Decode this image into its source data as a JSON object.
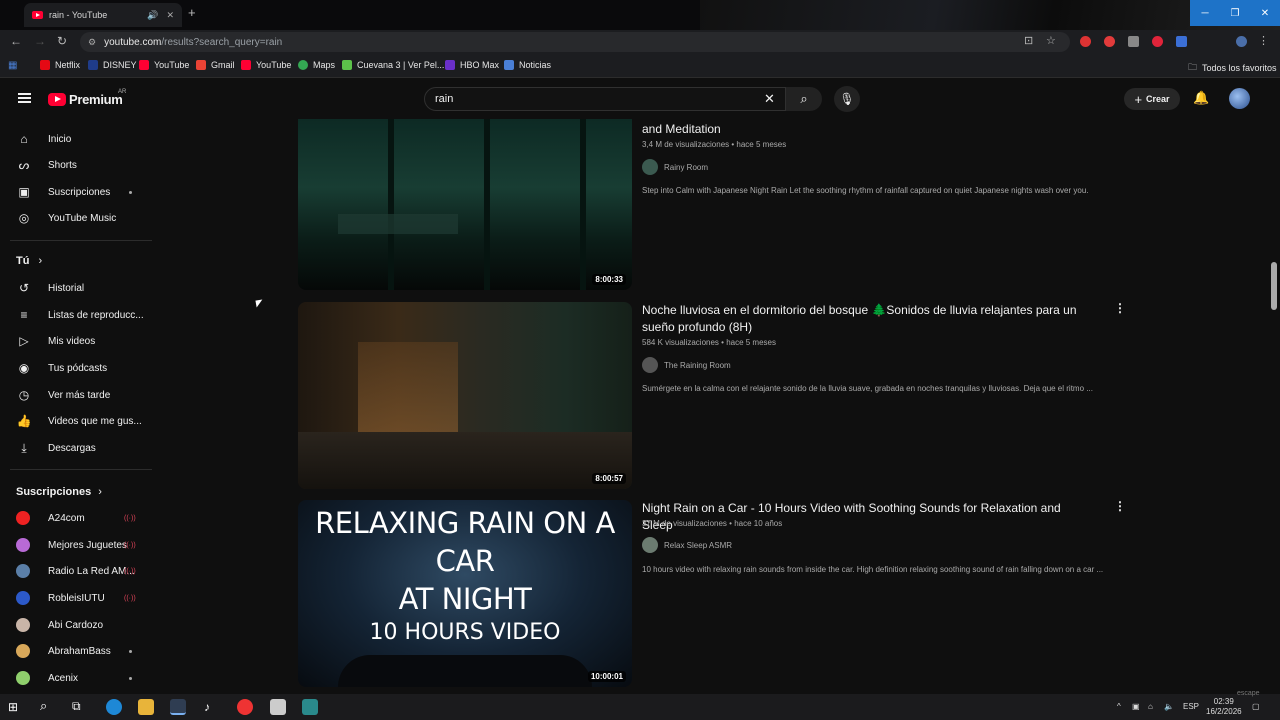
{
  "browser": {
    "tab_title": "rain - YouTube",
    "new_tab_icon": "+",
    "url_domain": "youtube.com",
    "url_path": "/results?search_query=rain",
    "bookmarks": [
      {
        "label": "Netflix",
        "color": "#e50914"
      },
      {
        "label": "DISNEY",
        "color": "#1f3c8a"
      },
      {
        "label": "YouTube",
        "color": "#ff0033"
      },
      {
        "label": "Gmail",
        "color": "#ea4335"
      },
      {
        "label": "YouTube",
        "color": "#ff0033"
      },
      {
        "label": "Maps",
        "color": "#34a853"
      },
      {
        "label": "Cuevana 3 | Ver Pel...",
        "color": "#5cc24a"
      },
      {
        "label": "HBO Max",
        "color": "#6a2fc9"
      },
      {
        "label": "Noticias",
        "color": "#4a7fd6"
      }
    ],
    "favorites_label": "Todos los favoritos"
  },
  "header": {
    "logo_text": "Premium",
    "logo_region": "AR",
    "search_query": "rain",
    "create_label": "Crear"
  },
  "sidebar": {
    "main": [
      {
        "label": "Inicio",
        "icon": "home-icon"
      },
      {
        "label": "Shorts",
        "icon": "shorts-icon"
      },
      {
        "label": "Suscripciones",
        "icon": "subscriptions-icon"
      },
      {
        "label": "YouTube Music",
        "icon": "music-icon"
      }
    ],
    "you_heading": "Tú",
    "you": [
      {
        "label": "Historial",
        "icon": "history-icon"
      },
      {
        "label": "Listas de reproducc...",
        "icon": "playlists-icon"
      },
      {
        "label": "Mis videos",
        "icon": "my-videos-icon"
      },
      {
        "label": "Tus pódcasts",
        "icon": "podcasts-icon"
      },
      {
        "label": "Ver más tarde",
        "icon": "watch-later-icon"
      },
      {
        "label": "Videos que me gus...",
        "icon": "liked-icon"
      },
      {
        "label": "Descargas",
        "icon": "downloads-icon"
      }
    ],
    "subs_heading": "Suscripciones",
    "subs": [
      {
        "label": "A24com",
        "color": "#e22",
        "live": true
      },
      {
        "label": "Mejores Juguetes",
        "color": "#b86ad6",
        "live": true
      },
      {
        "label": "Radio La Red AM...",
        "color": "#5b7fa8",
        "live": true
      },
      {
        "label": "RobleisIUTU",
        "color": "#2c59c9",
        "live": true
      },
      {
        "label": "Abi Cardozo",
        "color": "#c9b5a8",
        "live": false
      },
      {
        "label": "AbrahamBass",
        "color": "#d8a85a",
        "live": false,
        "new": true
      },
      {
        "label": "Acenix",
        "color": "#8fcf6c",
        "live": false,
        "new": true
      }
    ]
  },
  "results": [
    {
      "title": "and Meditation",
      "views": "3,4 M de visualizaciones",
      "age": "hace 5 meses",
      "channel": "Rainy Room",
      "description": "Step into Calm with Japanese Night Rain Let the soothing rhythm of rainfall captured on quiet Japanese nights wash over you.",
      "duration": "8:00:33"
    },
    {
      "title": "Noche lluviosa en el dormitorio del bosque 🌲Sonidos de lluvia relajantes para un sueño profundo (8H)",
      "views": "584 K visualizaciones",
      "age": "hace 5 meses",
      "channel": "The Raining Room",
      "description": "Sumérgete en la calma con el relajante sonido de la lluvia suave, grabada en noches tranquilas y lluviosas. Deja que el ritmo ...",
      "duration": "8:00:57"
    },
    {
      "title": "Night Rain on a Car - 10 Hours Video with Soothing Sounds for Relaxation and Sleep",
      "views": "37 M de visualizaciones",
      "age": "hace 10 años",
      "channel": "Relax Sleep ASMR",
      "description": "10 hours video with relaxing rain sounds from inside the car. High definition relaxing soothing sound of rain falling down on a car ...",
      "duration": "10:00:01",
      "thumb_text_1": "RELAXING RAIN ON A CAR",
      "thumb_text_2": "AT NIGHT",
      "thumb_text_3": "10 HOURS VIDEO"
    }
  ],
  "taskbar": {
    "lang": "ESP",
    "time": "02:39",
    "date": "16/2/2026",
    "watermark": "escape"
  }
}
